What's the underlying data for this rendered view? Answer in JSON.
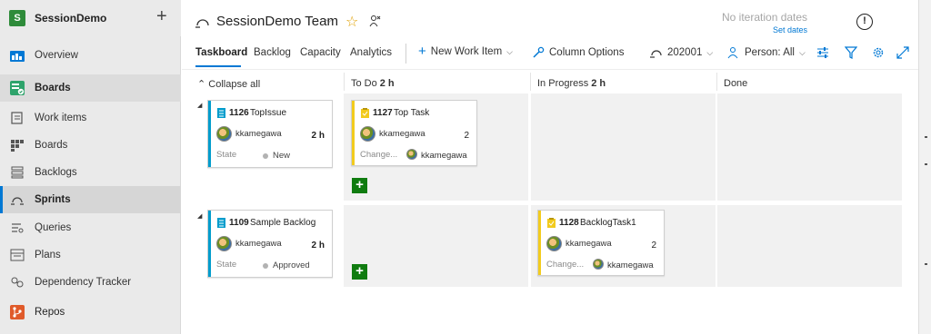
{
  "project": {
    "name": "SessionDemo",
    "badge": "S",
    "add": "+"
  },
  "nav": [
    {
      "id": "overview",
      "label": "Overview"
    },
    {
      "id": "boards",
      "label": "Boards"
    },
    {
      "id": "work-items",
      "label": "Work items"
    },
    {
      "id": "boards-sub",
      "label": "Boards"
    },
    {
      "id": "backlogs",
      "label": "Backlogs"
    },
    {
      "id": "sprints",
      "label": "Sprints"
    },
    {
      "id": "queries",
      "label": "Queries"
    },
    {
      "id": "plans",
      "label": "Plans"
    },
    {
      "id": "dependency",
      "label": "Dependency Tracker"
    },
    {
      "id": "repos",
      "label": "Repos"
    }
  ],
  "header": {
    "team": "SessionDemo Team",
    "chevron": "⌵",
    "star": "☆",
    "iteration_dates": "No iteration dates",
    "set_dates": "Set dates",
    "alert": "!"
  },
  "tabs": [
    "Taskboard",
    "Backlog",
    "Capacity",
    "Analytics"
  ],
  "toolbar": {
    "new_item": "New Work Item",
    "column_options": "Column Options",
    "sprint": "202001",
    "person": "Person: All"
  },
  "board": {
    "collapse": "Collapse all",
    "columns": [
      {
        "name": "To Do",
        "hours": "2 h"
      },
      {
        "name": "In Progress",
        "hours": "2 h"
      },
      {
        "name": "Done",
        "hours": ""
      }
    ],
    "rows": [
      {
        "backlog": {
          "id": "1126",
          "title": "TopIssue",
          "assignee": "kkamegawa",
          "hours": "2 h",
          "field": "State",
          "state": "New"
        },
        "todo": {
          "id": "1127",
          "title": "Top Task",
          "assignee": "kkamegawa",
          "hours": "2",
          "field": "Change...",
          "changed_by": "kkamegawa"
        }
      },
      {
        "backlog": {
          "id": "1109",
          "title": "Sample Backlog",
          "assignee": "kkamegawa",
          "hours": "2 h",
          "field": "State",
          "state": "Approved"
        },
        "inprogress": {
          "id": "1128",
          "title": "BacklogTask1",
          "assignee": "kkamegawa",
          "hours": "2",
          "field": "Change...",
          "changed_by": "kkamegawa"
        }
      }
    ],
    "add": "+"
  },
  "colors": {
    "accent": "#0078d4",
    "backlog_bar": "#009ccc",
    "task_bar": "#f2cb1d",
    "add": "#107c10"
  }
}
